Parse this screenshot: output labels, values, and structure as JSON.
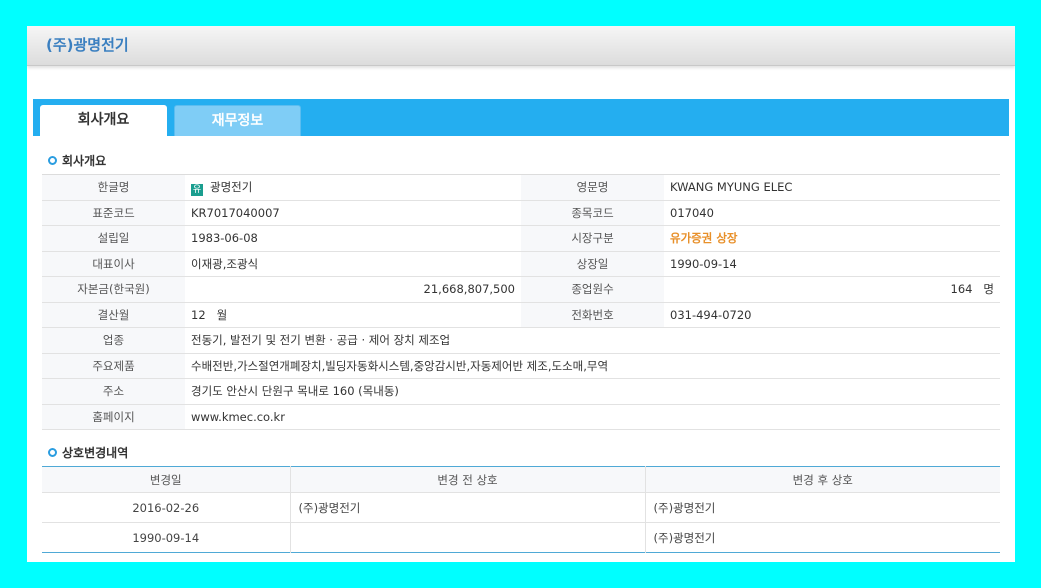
{
  "header": {
    "company_title": "(주)광명전기"
  },
  "tabs": [
    {
      "label": "회사개요",
      "active": true
    },
    {
      "label": "재무정보",
      "active": false
    }
  ],
  "overview": {
    "section_title": "회사개요",
    "rows": [
      {
        "l1": "한글명",
        "v1": "광명전기",
        "badge": "유",
        "l2": "영문명",
        "v2": "KWANG MYUNG ELEC"
      },
      {
        "l1": "표준코드",
        "v1": "KR7017040007",
        "l2": "종목코드",
        "v2": "017040"
      },
      {
        "l1": "설립일",
        "v1": "1983-06-08",
        "l2": "시장구분",
        "v2": "유가증권 상장"
      },
      {
        "l1": "대표이사",
        "v1": "이재광,조광식",
        "l2": "상장일",
        "v2": "1990-09-14"
      },
      {
        "l1": "자본금(한국원)",
        "v1": "21,668,807,500",
        "l2": "종업원수",
        "v2": "164   명"
      },
      {
        "l1": "결산월",
        "v1": "12   월",
        "l2": "전화번호",
        "v2": "031-494-0720"
      }
    ],
    "wide_rows": [
      {
        "label": "업종",
        "value": "전동기, 발전기 및 전기 변환 · 공급 · 제어 장치 제조업"
      },
      {
        "label": "주요제품",
        "value": "수배전반,가스절연개폐장치,빌딩자동화시스템,중앙감시반,자동제어반 제조,도소매,무역"
      },
      {
        "label": "주소",
        "value": "경기도 안산시 단원구 목내로 160 (목내동)"
      },
      {
        "label": "홈페이지",
        "value": "www.kmec.co.kr"
      }
    ]
  },
  "history": {
    "section_title": "상호변경내역",
    "columns": [
      "변경일",
      "변경 전 상호",
      "변경 후 상호"
    ],
    "rows": [
      {
        "date": "2016-02-26",
        "before": "(주)광명전기",
        "after": "(주)광명전기"
      },
      {
        "date": "1990-09-14",
        "before": "",
        "after": "(주)광명전기"
      }
    ]
  },
  "colors": {
    "background": "#00ffff",
    "tab_bar": "#24aef0",
    "title": "#3a7fc0",
    "market_status": "#e8902a"
  }
}
